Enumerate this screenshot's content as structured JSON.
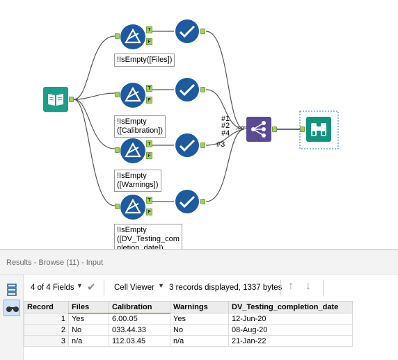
{
  "workflow": {
    "filters": [
      {
        "expression": "!IsEmpty([Files])"
      },
      {
        "expression": "!IsEmpty\n([Calibration])"
      },
      {
        "expression": "!IsEmpty\n([Warnings])"
      },
      {
        "expression": "!IsEmpty\n([DV_Testing_com\npletion_date])"
      }
    ],
    "anchor_true": "T",
    "anchor_false": "F",
    "connection_labels": [
      "#1",
      "#2",
      "#4",
      "#3"
    ],
    "colors": {
      "tool_blue": "#1d5aa0",
      "input_teal": "#1aa08a",
      "union_purple": "#5a4a93",
      "browse_teal": "#12947c",
      "anchor_green": "#a6cf5c"
    },
    "icons": {
      "input": "book-icon",
      "filter": "filter-triangle-icon",
      "test": "checkmark-icon",
      "union": "union-icon",
      "browse": "binoculars-icon"
    }
  },
  "results": {
    "title": "Results - Browse (11) - Input",
    "fields_label": "4 of 4 Fields",
    "viewer_label": "Cell Viewer",
    "summary": "3 records displayed, 1337 bytes",
    "columns": [
      "Record",
      "Files",
      "Calibration",
      "Warnings",
      "DV_Testing_completion_date"
    ],
    "rows": [
      [
        "1",
        "Yes",
        "6.00.05",
        "Yes",
        "12-Jun-20"
      ],
      [
        "2",
        "No",
        "033.44.33",
        "No",
        "08-Aug-20"
      ],
      [
        "3",
        "n/a",
        "112.03.45",
        "n/a",
        "21-Jan-22"
      ]
    ]
  }
}
